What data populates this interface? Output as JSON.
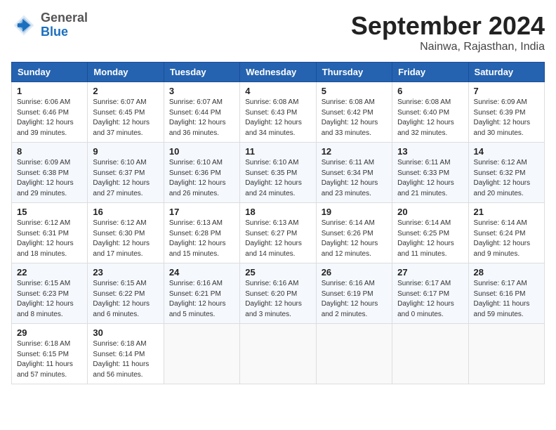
{
  "header": {
    "logo": {
      "general": "General",
      "blue": "Blue"
    },
    "title": "September 2024",
    "location": "Nainwa, Rajasthan, India"
  },
  "calendar": {
    "columns": [
      "Sunday",
      "Monday",
      "Tuesday",
      "Wednesday",
      "Thursday",
      "Friday",
      "Saturday"
    ],
    "weeks": [
      [
        {
          "day": "1",
          "info": "Sunrise: 6:06 AM\nSunset: 6:46 PM\nDaylight: 12 hours and 39 minutes."
        },
        {
          "day": "2",
          "info": "Sunrise: 6:07 AM\nSunset: 6:45 PM\nDaylight: 12 hours and 37 minutes."
        },
        {
          "day": "3",
          "info": "Sunrise: 6:07 AM\nSunset: 6:44 PM\nDaylight: 12 hours and 36 minutes."
        },
        {
          "day": "4",
          "info": "Sunrise: 6:08 AM\nSunset: 6:43 PM\nDaylight: 12 hours and 34 minutes."
        },
        {
          "day": "5",
          "info": "Sunrise: 6:08 AM\nSunset: 6:42 PM\nDaylight: 12 hours and 33 minutes."
        },
        {
          "day": "6",
          "info": "Sunrise: 6:08 AM\nSunset: 6:40 PM\nDaylight: 12 hours and 32 minutes."
        },
        {
          "day": "7",
          "info": "Sunrise: 6:09 AM\nSunset: 6:39 PM\nDaylight: 12 hours and 30 minutes."
        }
      ],
      [
        {
          "day": "8",
          "info": "Sunrise: 6:09 AM\nSunset: 6:38 PM\nDaylight: 12 hours and 29 minutes."
        },
        {
          "day": "9",
          "info": "Sunrise: 6:10 AM\nSunset: 6:37 PM\nDaylight: 12 hours and 27 minutes."
        },
        {
          "day": "10",
          "info": "Sunrise: 6:10 AM\nSunset: 6:36 PM\nDaylight: 12 hours and 26 minutes."
        },
        {
          "day": "11",
          "info": "Sunrise: 6:10 AM\nSunset: 6:35 PM\nDaylight: 12 hours and 24 minutes."
        },
        {
          "day": "12",
          "info": "Sunrise: 6:11 AM\nSunset: 6:34 PM\nDaylight: 12 hours and 23 minutes."
        },
        {
          "day": "13",
          "info": "Sunrise: 6:11 AM\nSunset: 6:33 PM\nDaylight: 12 hours and 21 minutes."
        },
        {
          "day": "14",
          "info": "Sunrise: 6:12 AM\nSunset: 6:32 PM\nDaylight: 12 hours and 20 minutes."
        }
      ],
      [
        {
          "day": "15",
          "info": "Sunrise: 6:12 AM\nSunset: 6:31 PM\nDaylight: 12 hours and 18 minutes."
        },
        {
          "day": "16",
          "info": "Sunrise: 6:12 AM\nSunset: 6:30 PM\nDaylight: 12 hours and 17 minutes."
        },
        {
          "day": "17",
          "info": "Sunrise: 6:13 AM\nSunset: 6:28 PM\nDaylight: 12 hours and 15 minutes."
        },
        {
          "day": "18",
          "info": "Sunrise: 6:13 AM\nSunset: 6:27 PM\nDaylight: 12 hours and 14 minutes."
        },
        {
          "day": "19",
          "info": "Sunrise: 6:14 AM\nSunset: 6:26 PM\nDaylight: 12 hours and 12 minutes."
        },
        {
          "day": "20",
          "info": "Sunrise: 6:14 AM\nSunset: 6:25 PM\nDaylight: 12 hours and 11 minutes."
        },
        {
          "day": "21",
          "info": "Sunrise: 6:14 AM\nSunset: 6:24 PM\nDaylight: 12 hours and 9 minutes."
        }
      ],
      [
        {
          "day": "22",
          "info": "Sunrise: 6:15 AM\nSunset: 6:23 PM\nDaylight: 12 hours and 8 minutes."
        },
        {
          "day": "23",
          "info": "Sunrise: 6:15 AM\nSunset: 6:22 PM\nDaylight: 12 hours and 6 minutes."
        },
        {
          "day": "24",
          "info": "Sunrise: 6:16 AM\nSunset: 6:21 PM\nDaylight: 12 hours and 5 minutes."
        },
        {
          "day": "25",
          "info": "Sunrise: 6:16 AM\nSunset: 6:20 PM\nDaylight: 12 hours and 3 minutes."
        },
        {
          "day": "26",
          "info": "Sunrise: 6:16 AM\nSunset: 6:19 PM\nDaylight: 12 hours and 2 minutes."
        },
        {
          "day": "27",
          "info": "Sunrise: 6:17 AM\nSunset: 6:17 PM\nDaylight: 12 hours and 0 minutes."
        },
        {
          "day": "28",
          "info": "Sunrise: 6:17 AM\nSunset: 6:16 PM\nDaylight: 11 hours and 59 minutes."
        }
      ],
      [
        {
          "day": "29",
          "info": "Sunrise: 6:18 AM\nSunset: 6:15 PM\nDaylight: 11 hours and 57 minutes."
        },
        {
          "day": "30",
          "info": "Sunrise: 6:18 AM\nSunset: 6:14 PM\nDaylight: 11 hours and 56 minutes."
        },
        null,
        null,
        null,
        null,
        null
      ]
    ]
  }
}
